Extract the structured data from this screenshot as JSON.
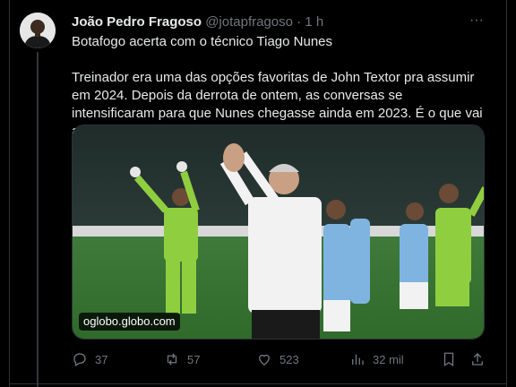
{
  "tweet": {
    "author_name": "João Pedro Fragoso",
    "handle": "@jotapfragoso",
    "separator": "·",
    "time": "1 h",
    "more_label": "···",
    "headline": "Botafogo acerta com o técnico Tiago Nunes",
    "body": "Treinador era uma das opções favoritas de John Textor pra assumir em 2024. Depois da derrota de ontem, as conversas se intensificaram para que Nunes chegasse ainda em 2023. É o que vai acontecer.",
    "media": {
      "source_label": "oglobo.globo.com",
      "icons": [
        "avatar",
        "photo"
      ]
    },
    "actions": {
      "replies": "37",
      "reposts": "57",
      "likes": "523",
      "views": "32 mil"
    }
  },
  "icons": {
    "reply": "reply-icon",
    "repost": "repost-icon",
    "like": "heart-icon",
    "views": "views-icon",
    "bookmark": "bookmark-icon",
    "share": "share-icon",
    "more": "more-icon"
  },
  "colors": {
    "background": "#000000",
    "text": "#e7e9ea",
    "muted": "#71767b",
    "border": "#2f3336"
  }
}
